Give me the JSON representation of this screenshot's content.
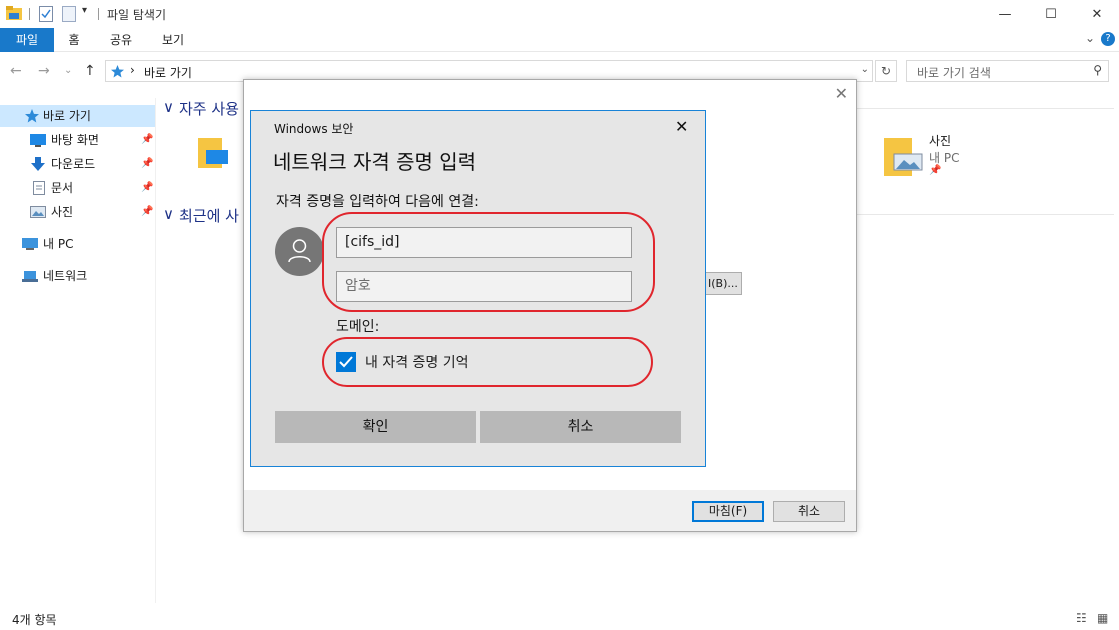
{
  "window": {
    "title": "파일 탐색기",
    "minimize": "—",
    "maximize": "☐",
    "close": "✕"
  },
  "ribbon": {
    "tabs": [
      "파일",
      "홈",
      "공유",
      "보기"
    ],
    "help": "?",
    "expand": "⌄"
  },
  "nav": {
    "back": "←",
    "forward": "→",
    "recent": "⌄",
    "up": "↑",
    "address": "바로 가기",
    "address_sep": "›",
    "search_placeholder": "바로 가기 검색"
  },
  "sidebar": {
    "quick_access": "바로 가기",
    "items": [
      {
        "label": "바탕 화면",
        "pinned": true
      },
      {
        "label": "다운로드",
        "pinned": true
      },
      {
        "label": "문서",
        "pinned": true
      },
      {
        "label": "사진",
        "pinned": true
      }
    ],
    "this_pc": "내 PC",
    "network": "네트워크",
    "pin_glyph": "📌"
  },
  "main": {
    "frequent_header": "자주 사용",
    "recent_header": "최근에 사",
    "chevron": "∨",
    "photo_folder": {
      "name": "사진",
      "location": "내 PC"
    }
  },
  "status": {
    "item_count": "4개 항목"
  },
  "wizard": {
    "partial_button": "I(B)...",
    "finish_button": "마침(F)",
    "cancel_button": "취소",
    "close": "✕"
  },
  "security_dialog": {
    "title": "Windows 보안",
    "close": "✕",
    "heading": "네트워크 자격 증명 입력",
    "subheading": "자격 증명을 입력하여 다음에 연결:",
    "username_value": "[cifs_id]",
    "password_placeholder": "암호",
    "domain_label": "도메인:",
    "remember_label": "내 자격 증명 기억",
    "remember_checked": true,
    "ok_button": "확인",
    "cancel_button": "취소"
  },
  "colors": {
    "accent": "#0078d7",
    "highlight": "#e0262d",
    "ribbon_file": "#1979ca"
  }
}
